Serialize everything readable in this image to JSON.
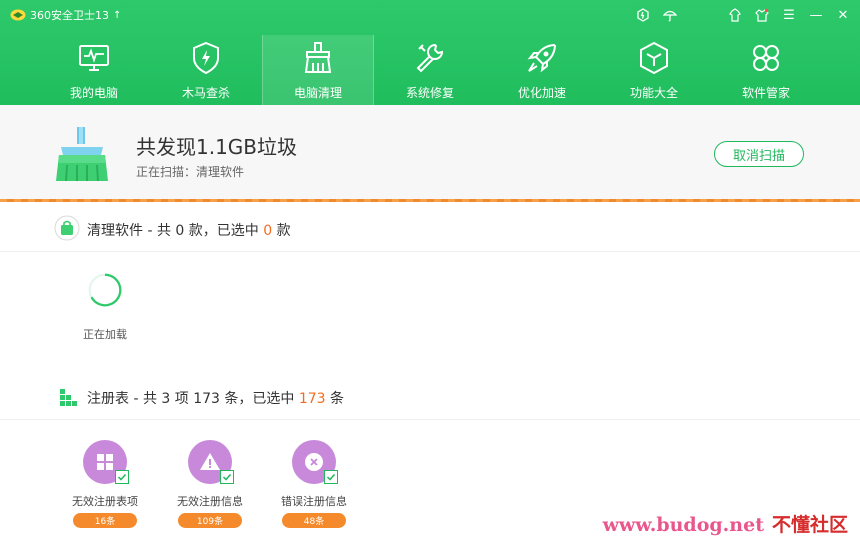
{
  "app": {
    "title": "360安全卫士13",
    "upgrade_symbol": "↑"
  },
  "window_controls": {
    "minimize": "—",
    "close": "✕",
    "menu": "☰"
  },
  "nav": {
    "items": [
      {
        "label": "我的电脑",
        "icon": "monitor-icon"
      },
      {
        "label": "木马查杀",
        "icon": "shield-icon"
      },
      {
        "label": "电脑清理",
        "icon": "broom-icon",
        "active": true
      },
      {
        "label": "系统修复",
        "icon": "wrench-icon"
      },
      {
        "label": "优化加速",
        "icon": "rocket-icon"
      },
      {
        "label": "功能大全",
        "icon": "cube-icon"
      },
      {
        "label": "软件管家",
        "icon": "apps-icon"
      }
    ]
  },
  "scan": {
    "title": "共发现1.1GB垃圾",
    "subtitle": "正在扫描：清理软件",
    "cancel_label": "取消扫描"
  },
  "software_section": {
    "prefix": "清理软件 - 共 0 款，已选中 ",
    "selected": "0",
    "suffix": " 款",
    "loading_label": "正在加载"
  },
  "registry_section": {
    "prefix": "注册表 - 共 3 项 173 条，已选中 ",
    "selected": "173",
    "suffix": " 条",
    "items": [
      {
        "label": "无效注册表项",
        "count": "16条",
        "icon": "grid-icon"
      },
      {
        "label": "无效注册信息",
        "count": "109条",
        "icon": "warning-icon"
      },
      {
        "label": "错误注册信息",
        "count": "48条",
        "icon": "error-icon"
      }
    ]
  },
  "watermark": {
    "latin": "www.budog.net",
    "cn": "不懂社区"
  },
  "colors": {
    "brand_green": "#20bd5d",
    "accent_orange": "#f26d21",
    "registry_purple": "#c889db"
  }
}
